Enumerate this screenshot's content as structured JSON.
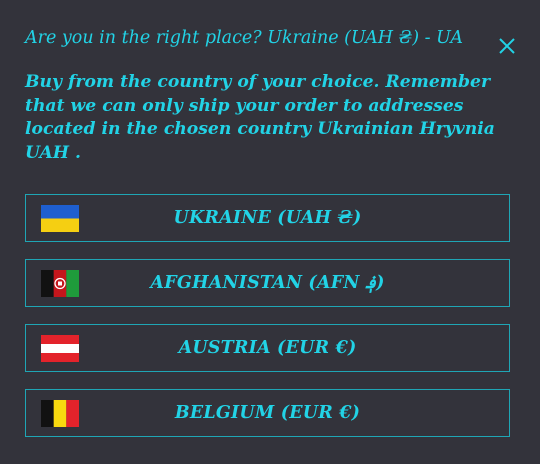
{
  "modal": {
    "title": "Are you in the right place? Ukraine (UAH ₴) - UA",
    "description": "Buy from the country of your choice. Remember that we can only ship your order to addresses located in the chosen country Ukrainian Hryvnia UAH .",
    "close_icon": "close-icon"
  },
  "countries": [
    {
      "label": "UKRAINE (UAH ₴)",
      "flag": "ukraine-flag-icon"
    },
    {
      "label": "AFGHANISTAN (AFN ؋)",
      "flag": "afghanistan-flag-icon"
    },
    {
      "label": "AUSTRIA (EUR €)",
      "flag": "austria-flag-icon"
    },
    {
      "label": "BELGIUM (EUR €)",
      "flag": "belgium-flag-icon"
    }
  ],
  "colors": {
    "background": "#33333b",
    "accent": "#22d3e6",
    "border": "#1fa6b5"
  }
}
